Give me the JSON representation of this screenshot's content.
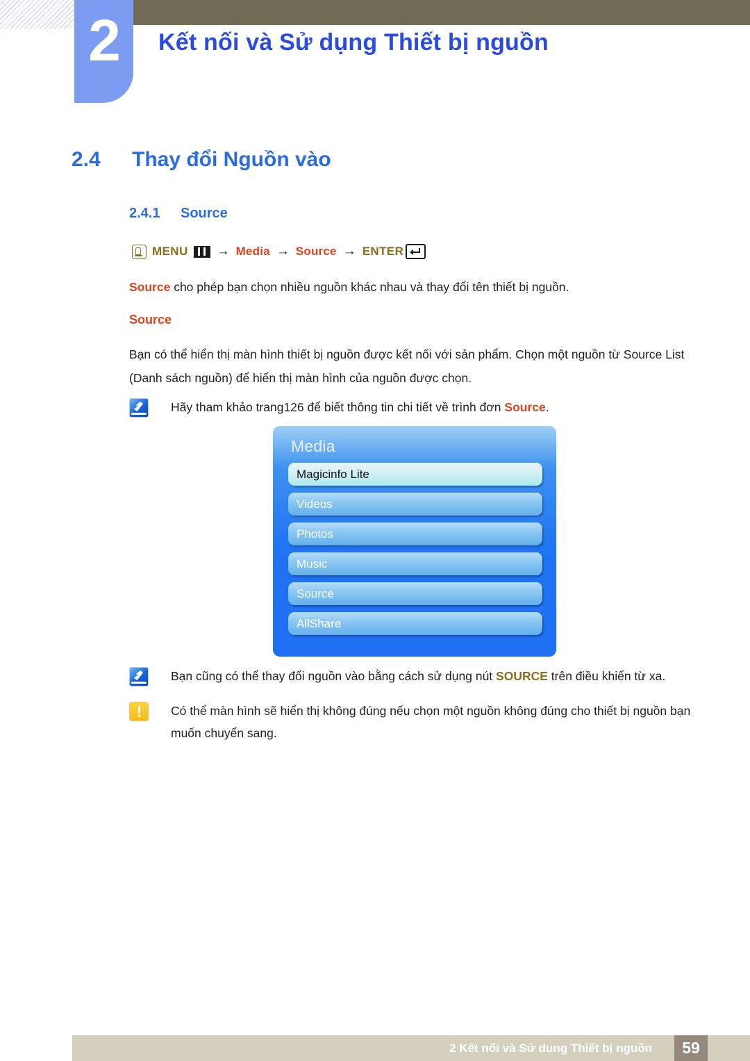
{
  "document": {
    "chapter_number": "2",
    "chapter_title": "Kết nối và Sử dụng Thiết bị nguồn"
  },
  "sections": {
    "h1_number": "2.4",
    "h1_title": "Thay đổi Nguồn vào",
    "h2_number": "2.4.1",
    "h2_title": "Source"
  },
  "menu_path": {
    "hand_icon": "hand-press-icon",
    "menu_label": "MENU",
    "grid_icon": "menu-grid-icon",
    "arrow1": "→",
    "media_label": "Media",
    "arrow2": "→",
    "source_label": "Source",
    "arrow3": "→",
    "enter_label": "ENTER",
    "enter_icon": "enter-key-icon"
  },
  "content": {
    "intro_bold": "Source",
    "intro_rest": " cho phép bạn chọn nhiều nguồn khác nhau và thay đổi tên thiết bị nguồn.",
    "sub_heading": "Source",
    "body_paragraph": "Bạn có thể hiển thị màn hình thiết bị nguồn được kết nối với sản phẩm. Chọn một nguồn từ Source List (Danh sách nguồn) để hiển thị màn hình của nguồn được chọn."
  },
  "notes": [
    {
      "icon": "note-pen-icon",
      "text_before": "Hãy tham khảo trang126 để biết thông tin chi tiết về trình đơn ",
      "highlight": "Source",
      "highlight_color": "#d9441f",
      "text_after": "."
    },
    {
      "icon": "note-pen-icon",
      "text_before": "Bạn cũng có thể thay đổi nguồn vào bằng cách sử dụng nút ",
      "highlight": "SOURCE",
      "highlight_color": "#8a6d1b",
      "text_after": " trên điều khiển từ xa."
    },
    {
      "icon": "warning-icon",
      "text_before": "Có thể màn hình sẽ hiển thị không đúng nếu chọn một nguồn không đúng cho thiết bị nguồn bạn muốn chuyển sang.",
      "highlight": "",
      "highlight_color": "",
      "text_after": ""
    }
  ],
  "osd": {
    "title": "Media",
    "items": [
      {
        "label": "Magicinfo Lite",
        "selected": true
      },
      {
        "label": "Videos",
        "selected": false
      },
      {
        "label": "Photos",
        "selected": false
      },
      {
        "label": "Music",
        "selected": false
      },
      {
        "label": "Source",
        "selected": false
      },
      {
        "label": "AllShare",
        "selected": false
      }
    ]
  },
  "footer": {
    "text": "2 Kết nối và Sử dụng Thiết bị nguồn",
    "page_number": "59"
  },
  "colors": {
    "heading_blue": "#2b6de0",
    "title_blue": "#2b4ae0",
    "accent_red": "#d9441f",
    "accent_gold": "#8a6d1b",
    "olive_bar": "#706b53",
    "tab_blue": "#7b9cf0",
    "footer_bar": "#d5cfbe",
    "footer_page_box": "#95897c"
  }
}
